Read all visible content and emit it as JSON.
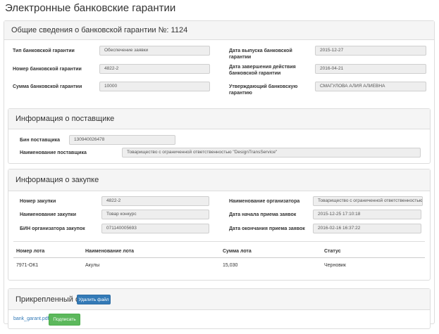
{
  "page": {
    "title": "Электронные банковские гарантии"
  },
  "general": {
    "heading": "Общие сведения о банковской гарантии №: 1124",
    "type_label": "Тип банковской гарантии",
    "type_value": "Обеспечение заявки",
    "number_label": "Номер банковской гарантии",
    "number_value": "4822-2",
    "sum_label": "Сумма банковской гарантии",
    "sum_value": "10000",
    "issue_date_label": "Дата выпуска банковской гарантии",
    "issue_date_value": "2015-12-27",
    "end_date_label": "Дата завершения действия банковской гарантии",
    "end_date_value": "2016-04-21",
    "approver_label": "Утверждающий банковскую гарантию",
    "approver_value": "СМАГУЛОВА АЛИЯ АЛИЕВНА"
  },
  "supplier": {
    "heading": "Информация о поставщике",
    "bin_label": "Бин поставщика",
    "bin_value": "130940026478",
    "name_label": "Наименование поставщика",
    "name_value": "Товарищество с ограниченной ответственностью \"DesignTransService\""
  },
  "purchase": {
    "heading": "Информация о закупке",
    "number_label": "Номер закупки",
    "number_value": "4822-2",
    "name_label": "Наименование закупки",
    "name_value": "Товар конкурс",
    "org_bin_label": "БИН организатора закупок",
    "org_bin_value": "071140005693",
    "org_name_label": "Наименование организатора",
    "org_name_value": "Товарищество с ограниченной ответственностью \"Ц",
    "start_label": "Дата начала приема заявок",
    "start_value": "2015-12-25 17:10:18",
    "end_label": "Дата окончания приема заявок",
    "end_value": "2016-02-16 16:37:22",
    "lots_table": {
      "headers": [
        "Номер лота",
        "Наименование лота",
        "Сумма лота",
        "Статус"
      ],
      "rows": [
        [
          "7971-ОК1",
          "Акулы",
          "15,030",
          "Черновик"
        ]
      ]
    }
  },
  "attachment": {
    "heading": "Прикрепленный файл",
    "delete_button": "Удалить файл",
    "file_name": "bank_garant.pdf",
    "sign_button": "Подписать"
  },
  "colors": {
    "primary": "#337ab7",
    "success": "#5cb85c",
    "panel_heading_bg": "#f5f5f5",
    "field_bg": "#eeeeee"
  }
}
